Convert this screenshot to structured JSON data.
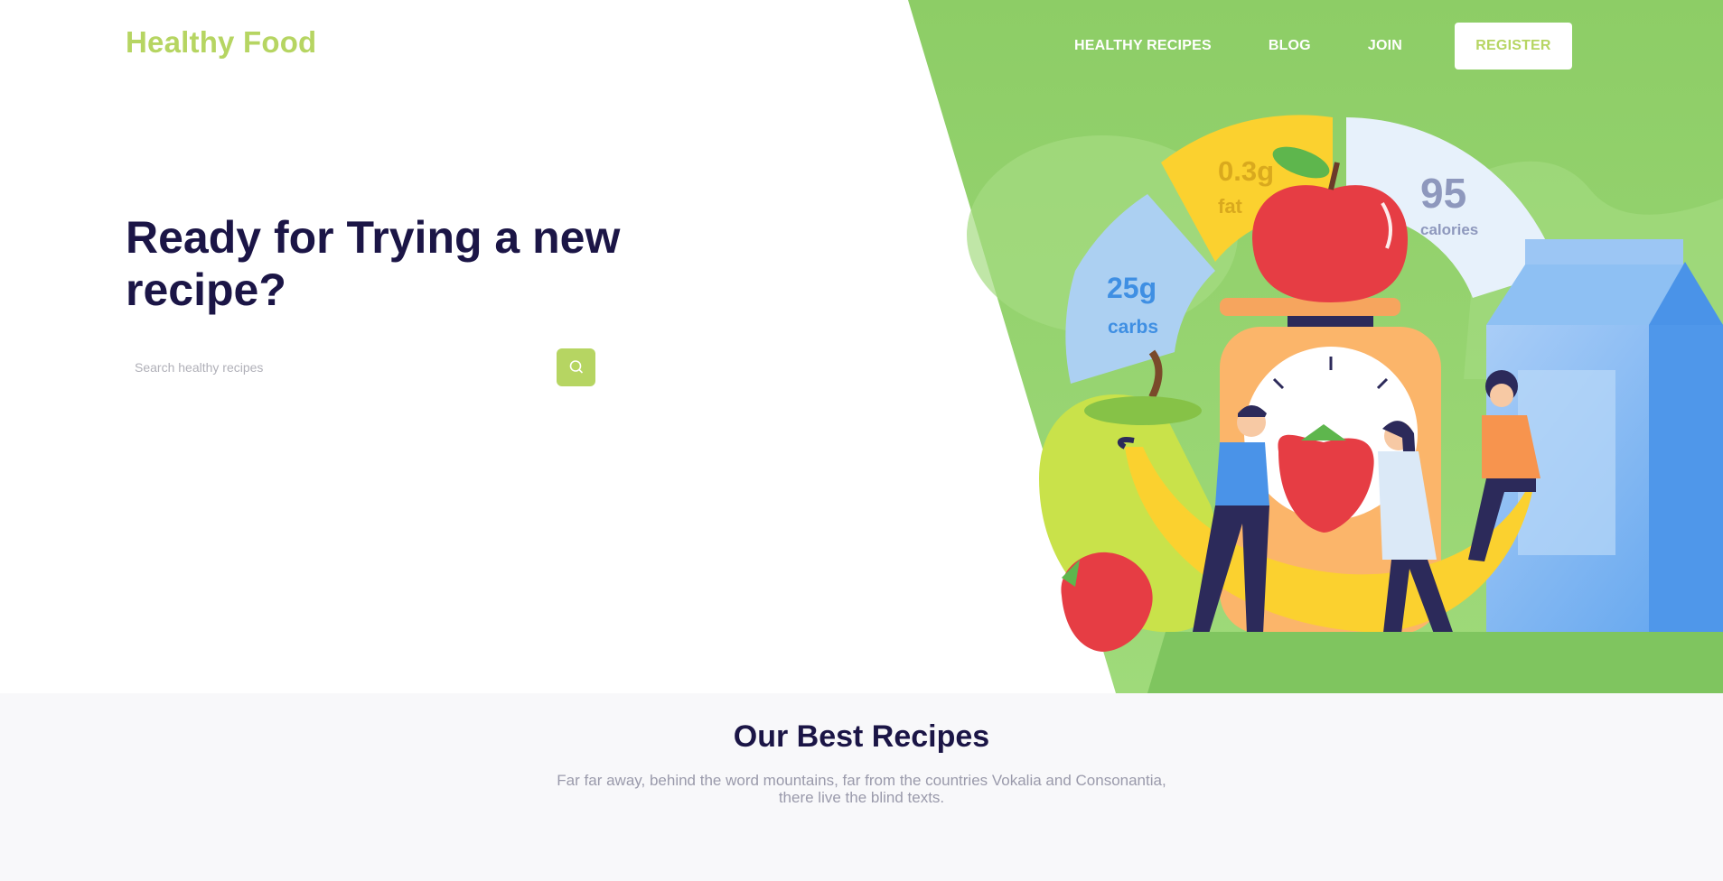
{
  "brand": {
    "logo": "Healthy Food",
    "accent": "#b6d562",
    "hero_green": "#8ccf6a",
    "heading_color": "#1b1546"
  },
  "nav": {
    "links": [
      "HEALTHY RECIPES",
      "BLOG",
      "JOIN"
    ],
    "register": "REGISTER"
  },
  "hero": {
    "headline": "Ready for Trying a new recipe?",
    "search_placeholder": "Search healthy recipes",
    "search_icon": "search-icon"
  },
  "illustration": {
    "fat_value": "0.3g",
    "fat_label": "fat",
    "calories_value": "95",
    "calories_label": "calories",
    "carbs_value": "25g",
    "carbs_label": "carbs"
  },
  "section": {
    "title": "Our Best Recipes",
    "subtitle_line1": "Far far away, behind the word mountains, far from the countries Vokalia and Consonantia,",
    "subtitle_line2": "there live the blind texts."
  }
}
